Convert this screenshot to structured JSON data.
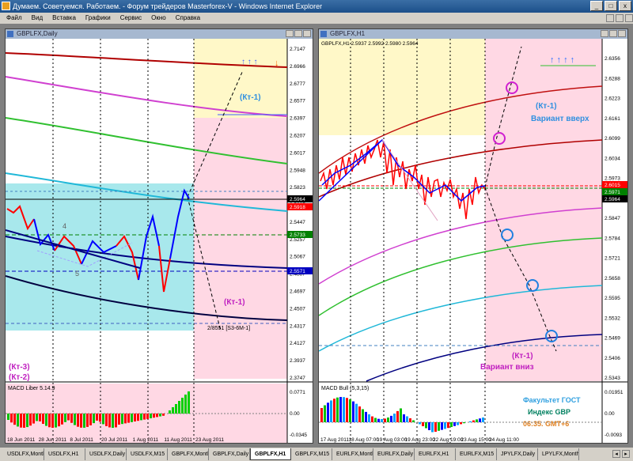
{
  "window": {
    "title": "Думаем. Советуемся. Работаем. - Форум трейдеров Masterforex-V - Windows Internet Explorer"
  },
  "menu": [
    "Файл",
    "Вид",
    "Вставка",
    "Графики",
    "Сервис",
    "Окно",
    "Справка"
  ],
  "left": {
    "caption": "GBPLFX,Daily",
    "labels": {
      "kt1": "(Кт-1)",
      "kt1b": "(Кт-1)",
      "kt3": "(Кт-3)",
      "kt2": "(Кт-2)",
      "w4": "4",
      "w5": "5",
      "s3": "2/8551 [S3-6M-1]"
    },
    "macd_caption": "MACD Liber 5.14.9",
    "prices": [
      "2.7147",
      "2.6966",
      "2.6777",
      "2.6577",
      "2.6397",
      "2.6207",
      "2.6017",
      "2.5948",
      "2.5823",
      "2.5637",
      "2.5447",
      "2.5257",
      "2.5067",
      "2.4887",
      "2.4697",
      "2.4507",
      "2.4317",
      "2.4127",
      "2.3937",
      "2.3747"
    ],
    "price_tags": {
      "cur": "2.5964",
      "red": "2.5918",
      "green": "2.5733",
      "blue": "2.5571"
    },
    "macd_prices": [
      "0.0771",
      "0.00",
      "-0.0345"
    ],
    "dates": [
      "18 Jun 2011",
      "28 Jun 2011",
      "8 Jul 2011",
      "20 Jul 2011",
      "1 Aug 2011",
      "11 Aug 2011",
      "23 Aug 2011"
    ]
  },
  "right": {
    "caption": "GBPLFX,H1",
    "ohlc": "GBPLFX,H1  2.5937 2.5992 2.5980 2.5964",
    "labels": {
      "kt1": "(Кт-1)",
      "up": "Вариант вверх",
      "kt1b": "(Кт-1)",
      "down": "Вариант вниз"
    },
    "macd_caption": "MACD Bull (5,3,15)",
    "info": {
      "line1": "Факультет ГОСТ",
      "line2": "Индекс GBP",
      "line3": "06:35. GMT+6"
    },
    "prices": [
      "2.6356",
      "2.6288",
      "2.6223",
      "2.6161",
      "2.6099",
      "2.6034",
      "2.5973",
      "2.5910",
      "2.5847",
      "2.5784",
      "2.5721",
      "2.5658",
      "2.5595",
      "2.5532",
      "2.5469",
      "2.5406",
      "2.5343"
    ],
    "price_tags": {
      "cur": "2.5964",
      "g1": "2.6015",
      "g2": "2.5971"
    },
    "macd_prices": [
      "0.01951",
      "0.00",
      "-0.0093"
    ],
    "dates": [
      "17 Aug 2011",
      "18 Aug 07:00",
      "19 Aug 03:00",
      "19 Aug 23:00",
      "22 Aug 19:00",
      "23 Aug 15:00",
      "24 Aug 11:00"
    ]
  },
  "tabs": [
    "USDLFX,Monthly",
    "USDLFX,H1",
    "USDLFX,Daily",
    "USDLFX,M15",
    "GBPLFX,Monthly",
    "GBPLFX,Daily",
    "GBPLFX,H1",
    "GBPLFX,M15",
    "EURLFX,Monthly",
    "EURLFX,Daily",
    "EURLFX,H1",
    "EURLFX,M15",
    "JPYLFX,Daily",
    "LPYLFX,Monthly"
  ],
  "active_tab": "GBPLFX,H1",
  "colors": {
    "up_bar": "#0000ff",
    "down_bar": "#ff0000",
    "pink_zone": "#ffd8e4",
    "cyan_zone": "#a8e8ec",
    "yellow_zone": "#fff8c8"
  }
}
